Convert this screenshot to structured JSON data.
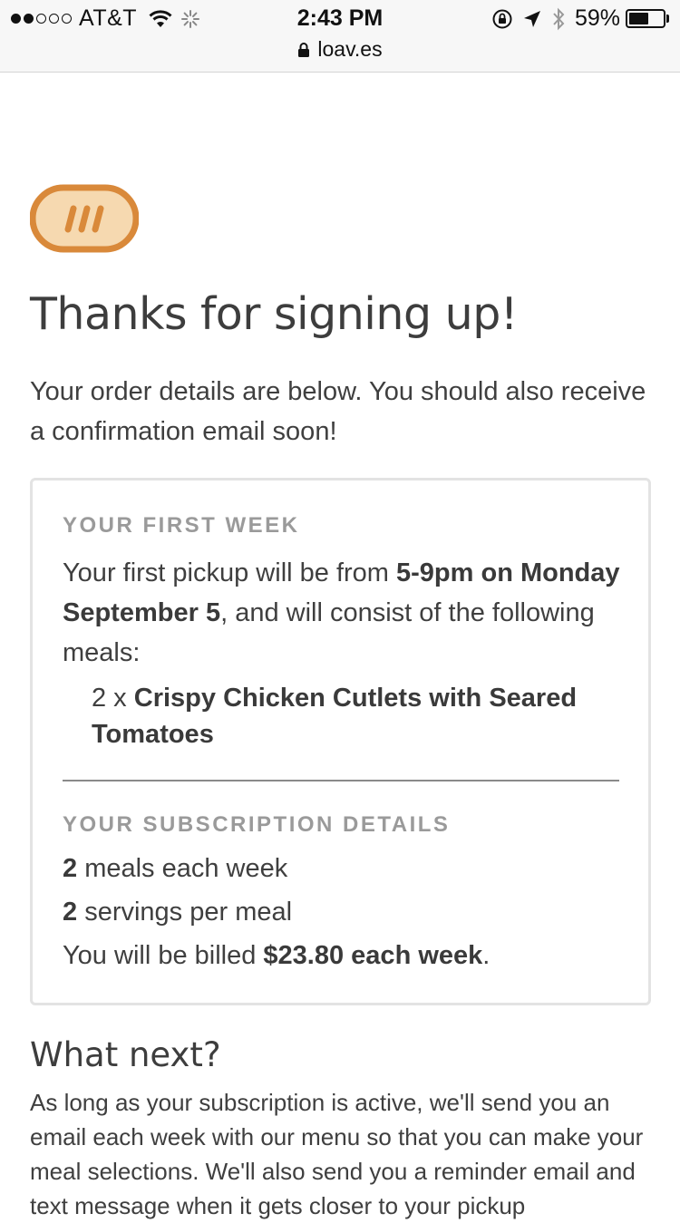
{
  "status_bar": {
    "carrier": "AT&T",
    "time": "2:43 PM",
    "battery_percent": "59%",
    "battery_level": 0.59,
    "signal_bars_filled": 2,
    "signal_bars_total": 5,
    "url": "loav.es"
  },
  "page": {
    "title": "Thanks for signing up!",
    "intro": "Your order details are below. You should also receive a confirmation email soon!",
    "first_week": {
      "heading": "YOUR FIRST WEEK",
      "text_before": "Your first pickup will be from ",
      "pickup_bold": "5-9pm on Monday September 5",
      "text_after": ", and will consist of the following meals:",
      "meal_qty": "2 x ",
      "meal_name": "Crispy Chicken Cutlets with Seared Tomatoes"
    },
    "subscription": {
      "heading": "YOUR SUBSCRIPTION DETAILS",
      "meals_count": "2",
      "meals_label": " meals each week",
      "servings_count": "2",
      "servings_label": " servings per meal",
      "billing_prefix": "You will be billed ",
      "billing_bold": "$23.80 each week",
      "billing_suffix": "."
    },
    "what_next": {
      "heading": "What next?",
      "text": "As long as your subscription is active, we'll send you an email each week with our menu so that you can make your meal selections. We'll also send you a reminder email and text message when it gets closer to your pickup"
    }
  },
  "colors": {
    "logo_orange": "#d9893a",
    "logo_fill": "#f6d9b0",
    "heading_gray": "#9a9a9a",
    "text": "#3f3f3f"
  }
}
